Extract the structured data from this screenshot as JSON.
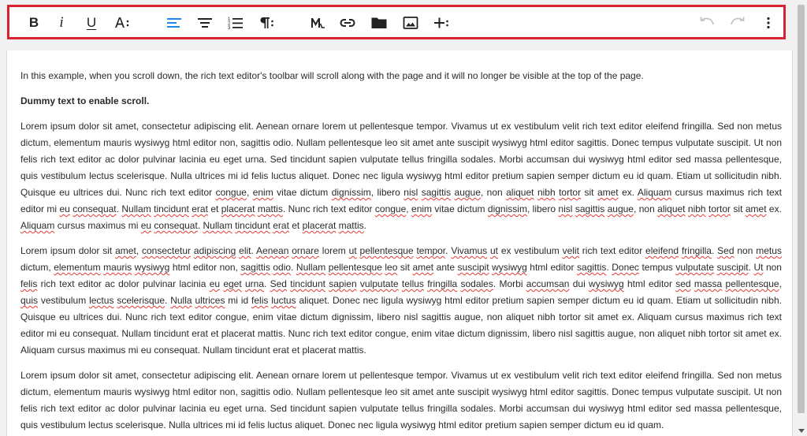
{
  "toolbar": {
    "buttons": [
      {
        "name": "bold",
        "label": "B",
        "icon": "bold-icon"
      },
      {
        "name": "italic",
        "label": "i",
        "icon": "italic-icon"
      },
      {
        "name": "underline",
        "label": "U",
        "icon": "underline-icon"
      },
      {
        "name": "text-format-more",
        "icon": "text-format-more-icon"
      },
      {
        "name": "align-left",
        "icon": "align-left-icon",
        "active": true
      },
      {
        "name": "align-center",
        "icon": "align-center-icon"
      },
      {
        "name": "ordered-list",
        "icon": "ordered-list-icon"
      },
      {
        "name": "paragraph-more",
        "icon": "paragraph-icon"
      },
      {
        "name": "markdown",
        "icon": "markdown-icon"
      },
      {
        "name": "insert-link",
        "icon": "link-icon"
      },
      {
        "name": "file-manager",
        "icon": "folder-icon"
      },
      {
        "name": "insert-image",
        "icon": "image-icon"
      },
      {
        "name": "insert-more",
        "icon": "plus-more-icon"
      },
      {
        "name": "undo",
        "icon": "undo-icon",
        "disabled": true
      },
      {
        "name": "redo",
        "icon": "redo-icon",
        "disabled": true
      },
      {
        "name": "more-options",
        "icon": "vertical-dots-icon"
      }
    ],
    "active_color": "#1e88e5",
    "disabled_color": "#c4c4c4",
    "highlight_border_color": "#d9222f"
  },
  "editor": {
    "intro": "In this example, when you scroll down, the rich text editor's toolbar will scroll along with the page and it will no longer be visible at the top of the page.",
    "heading": "Dummy text to enable scroll.",
    "paragraphs": [
      "Lorem ipsum dolor sit amet, consectetur adipiscing elit. Aenean ornare lorem ut pellentesque tempor. Vivamus ut ex vestibulum velit rich text editor eleifend fringilla. Sed non metus dictum, elementum mauris wysiwyg html editor non, sagittis odio. Nullam pellentesque leo sit amet ante suscipit wysiwyg html editor sagittis. Donec tempus vulputate suscipit. Ut non felis rich text editor ac dolor pulvinar lacinia eu eget urna. Sed tincidunt sapien vulputate tellus fringilla sodales. Morbi accumsan dui wysiwyg html editor sed massa pellentesque, quis vestibulum lectus scelerisque. Nulla ultrices mi id felis luctus aliquet. Donec nec ligula wysiwyg html editor pretium sapien semper dictum eu id quam. Etiam ut sollicitudin nibh. Quisque eu ultrices dui. Nunc rich text editor congue, enim vitae dictum dignissim, libero nisl sagittis augue, non aliquet nibh tortor sit amet ex. Aliquam cursus maximus rich text editor mi eu consequat. Nullam tincidunt erat et placerat mattis. Nunc rich text editor congue, enim vitae dictum dignissim, libero nisl sagittis augue, non aliquet nibh tortor sit amet ex. Aliquam cursus maximus mi eu consequat. Nullam tincidunt erat et placerat mattis.",
      "Lorem ipsum dolor sit amet, consectetur adipiscing elit. Aenean ornare lorem ut pellentesque tempor. Vivamus ut ex vestibulum velit rich text editor eleifend fringilla. Sed non metus dictum, elementum mauris wysiwyg html editor non, sagittis odio. Nullam pellentesque leo sit amet ante suscipit wysiwyg html editor sagittis. Donec tempus vulputate suscipit. Ut non felis rich text editor ac dolor pulvinar lacinia eu eget urna. Sed tincidunt sapien vulputate tellus fringilla sodales. Morbi accumsan dui wysiwyg html editor sed massa pellentesque, quis vestibulum lectus scelerisque. Nulla ultrices mi id felis luctus aliquet. Donec nec ligula wysiwyg html editor pretium sapien semper dictum eu id quam. Etiam ut sollicitudin nibh. Quisque eu ultrices dui. Nunc rich text editor congue, enim vitae dictum dignissim, libero nisl sagittis augue, non aliquet nibh tortor sit amet ex. Aliquam cursus maximus rich text editor mi eu consequat. Nullam tincidunt erat et placerat mattis. Nunc rich text editor congue, enim vitae dictum dignissim, libero nisl sagittis augue, non aliquet nibh tortor sit amet ex. Aliquam cursus maximus mi eu consequat. Nullam tincidunt erat et placerat mattis.",
      "Lorem ipsum dolor sit amet, consectetur adipiscing elit. Aenean ornare lorem ut pellentesque tempor. Vivamus ut ex vestibulum velit rich text editor eleifend fringilla. Sed non metus dictum, elementum mauris wysiwyg html editor non, sagittis odio. Nullam pellentesque leo sit amet ante suscipit wysiwyg html editor sagittis. Donec tempus vulputate suscipit. Ut non felis rich text editor ac dolor pulvinar lacinia eu eget urna. Sed tincidunt sapien vulputate tellus fringilla sodales. Morbi accumsan dui wysiwyg html editor sed massa pellentesque, quis vestibulum lectus scelerisque. Nulla ultrices mi id felis luctus aliquet. Donec nec ligula wysiwyg html editor pretium sapien semper dictum eu id quam."
    ],
    "spellcheck_words": [
      [
        "congue",
        "enim",
        "dignissim",
        "nisl",
        "sagittis",
        "augue",
        "aliquet",
        "nibh",
        "tortor",
        "amet",
        "Aliquam",
        "eu",
        "consequat",
        "Nullam",
        "tincidunt",
        "erat",
        "placerat",
        "mattis"
      ],
      [
        "amet",
        "consectetur",
        "adipiscing",
        "elit",
        "Aenean",
        "ornare",
        "pellentesque",
        "tempor",
        "Vivamus",
        "ut",
        "velit",
        "eleifend",
        "fringilla",
        "Sed",
        "metus",
        "elementum",
        "mauris",
        "wysiwyg",
        "sagittis",
        "odio",
        "Nullam",
        "leo",
        "suscipit",
        "Donec",
        "vulputate",
        "Ut",
        "felis",
        "eu",
        "eget",
        "urna",
        "tincidunt",
        "sapien",
        "tellus",
        "sodales",
        "accumsan",
        "sed",
        "massa",
        "quis",
        "lectus",
        "scelerisque",
        "Nulla",
        "ultrices",
        "luctus",
        "aliquet"
      ],
      []
    ],
    "spellcheck_limits": [
      null,
      "aliquet. Donec nec ligula",
      null
    ],
    "spellcheck_starts": [
      "congue, enim vitae dictum",
      null,
      null
    ]
  }
}
